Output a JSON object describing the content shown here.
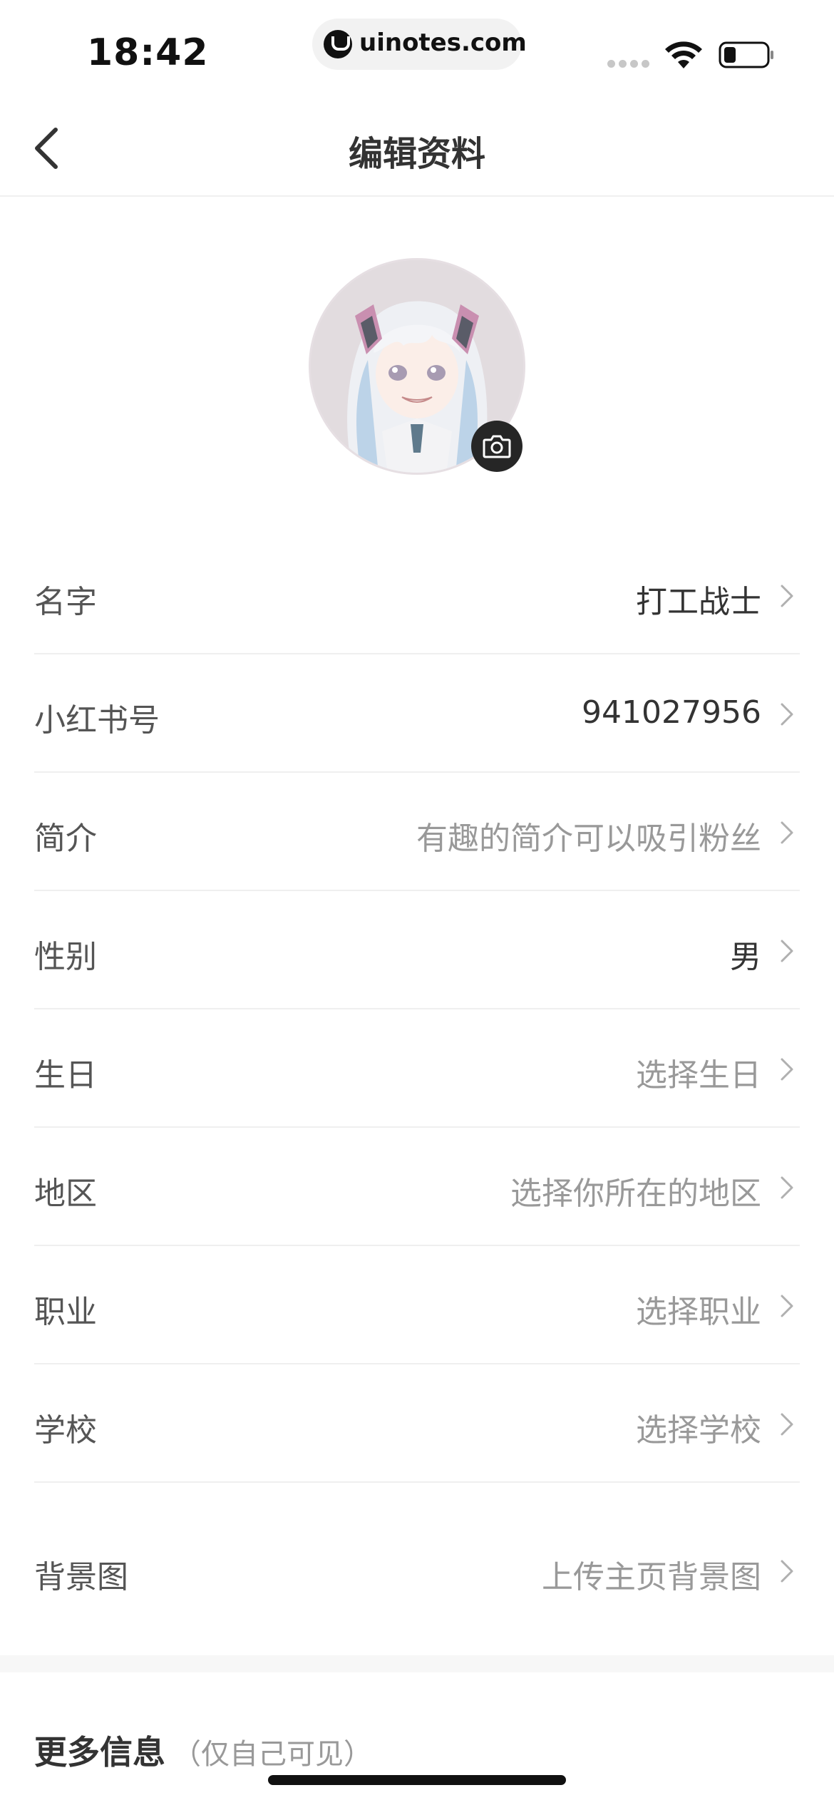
{
  "status_bar": {
    "time": "18:42",
    "url": "uinotes.com"
  },
  "header": {
    "title": "编辑资料"
  },
  "form": {
    "rows": [
      {
        "label": "名字",
        "value": "打工战士",
        "is_placeholder": false
      },
      {
        "label": "小红书号",
        "value": "941027956",
        "is_placeholder": false
      },
      {
        "label": "简介",
        "value": "有趣的简介可以吸引粉丝",
        "is_placeholder": true
      },
      {
        "label": "性别",
        "value": "男",
        "is_placeholder": false
      },
      {
        "label": "生日",
        "value": "选择生日",
        "is_placeholder": true
      },
      {
        "label": "地区",
        "value": "选择你所在的地区",
        "is_placeholder": true
      },
      {
        "label": "职业",
        "value": "选择职业",
        "is_placeholder": true
      },
      {
        "label": "学校",
        "value": "选择学校",
        "is_placeholder": true
      },
      {
        "label": "背景图",
        "value": "上传主页背景图",
        "is_placeholder": true
      }
    ]
  },
  "more_info": {
    "title": "更多信息",
    "note": "（仅自己可见）"
  },
  "icons": {
    "back": "chevron-left-icon",
    "camera": "camera-icon",
    "row_arrow": "chevron-right-icon",
    "wifi": "wifi-icon",
    "battery": "battery-icon"
  },
  "colors": {
    "placeholder": "#999999",
    "value": "#333333",
    "label": "#555555",
    "divider": "#efefef"
  }
}
